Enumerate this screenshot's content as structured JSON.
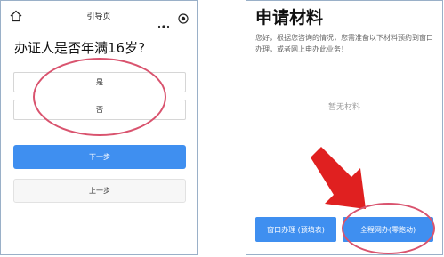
{
  "left_screen": {
    "nav": {
      "title": "引导页",
      "home_icon": "home-icon",
      "more_icon": "more-dots-icon",
      "target_icon": "target-icon"
    },
    "question": "办证人是否年满16岁?",
    "options": [
      {
        "label": "是"
      },
      {
        "label": "否"
      }
    ],
    "next_label": "下一步",
    "prev_label": "上一步",
    "annotation_color": "#d9536e"
  },
  "right_screen": {
    "heading": "申请材料",
    "description": "您好，根据您咨询的情况，您需准备以下材料预约到窗口办理，或者网上申办此业务！",
    "empty_text": "暂无材料",
    "buttons": {
      "window_label": "窗口办理 (预填表)",
      "online_label": "全程网办(零跑动)"
    },
    "arrow_color": "#e02020",
    "accent_color": "#3f8ff0"
  }
}
